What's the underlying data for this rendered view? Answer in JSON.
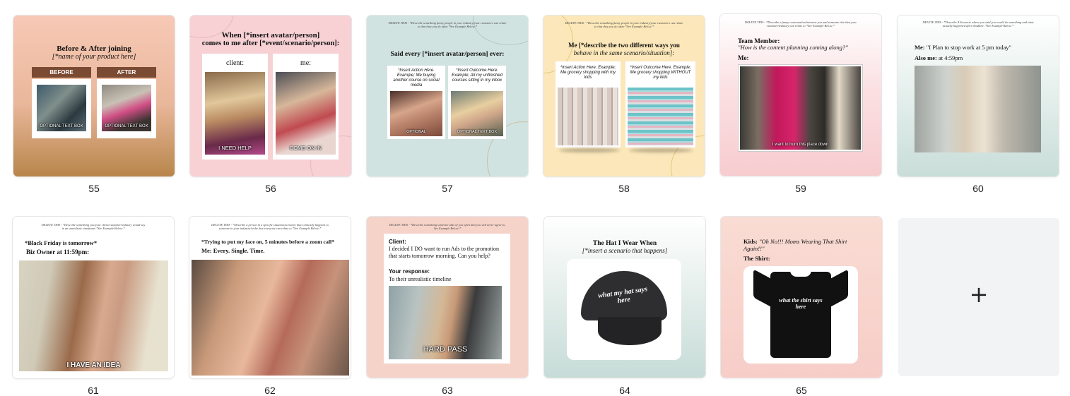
{
  "pages": [
    {
      "number": "55",
      "title_line1": "Before & After joining",
      "title_line2": "[*name of your product here]",
      "before_label": "BEFORE",
      "after_label": "AFTER",
      "caption_left": "OPTIONAL TEXT BOX",
      "caption_right": "OPTIONAL TEXT BOX"
    },
    {
      "number": "56",
      "title_line1": "When [*insert avatar/person]",
      "title_line2": "comes to me after [*event/scenario/person]:",
      "left_label": "client:",
      "right_label": "me:",
      "caption_left": "I NEED HELP",
      "caption_right": "COME ON IN"
    },
    {
      "number": "57",
      "note": "DELETE THIS - *Describe something funny people in your industry/your customers can relate to that they you do often *See Example Below:*",
      "title": "Said every [*insert avatar/person] ever:",
      "card_left": "*Insert Action Here. Example; Me buying another course on social media",
      "card_right": "*Insert Outcome Here. Example; All my unfinished courses sitting in my inbox",
      "caption_left": "OPTIONAL",
      "caption_right": "OPTIONAL TEXT BOX"
    },
    {
      "number": "58",
      "note": "DELETE THIS - *Describe something funny people in your industry/your customers can relate to that they you do often *See Example Below:*",
      "title_line1": "Me [*describe the two different ways you",
      "title_line2": "behave in the same scenario/situation]:",
      "card_left": "*Insert Action Here. Example; Me grocery shopping with my kids",
      "card_right": "*Insert Outcome Here. Example; Me grocery shopping WITHOUT my kids"
    },
    {
      "number": "59",
      "note": "DELETE THIS - *Describe a funny conversation between you and someone else that your customer/industry can relate to *See Example Below:*",
      "label_team": "Team Member:",
      "quote": "\"How is the content planning coming along?\"",
      "label_me": "Me:",
      "caption": "I want to burn this place down"
    },
    {
      "number": "60",
      "note": "DELETE THIS - *Describe A Scenario where you said you would do something and what actually happened after deadline. *See Example Below:*",
      "me_label": "Me:",
      "me_text": "\"I Plan to stop work at 5 pm today\"",
      "also_label": "Also me:",
      "also_text": "at 4:59pm"
    },
    {
      "number": "61",
      "note": "DELETE THIS - *Describe something you/your client/customer/industry would say in an unrealistic timeframe *See Example Below:*",
      "line1": "*Black Friday is tomorrow*",
      "line2": "Biz Owner at 11:59pm:",
      "caption": "I HAVE AN IDEA"
    },
    {
      "number": "62",
      "note": "DELETE THIS - *Describe a person in a specific situation/scenario that comically happens to someone in your industry/niche that everyone can relate to *See Example Below:*",
      "line1": "*Trying to put my face on, 5 minutes before a zoom call*",
      "line2": "Me: Every. Single. Time."
    },
    {
      "number": "63",
      "note": "DELETE THIS - *Describe something someone asks of you often that you will never agree to. See Example Below:*",
      "client_label": "Client:",
      "client_text": "I decided I DO want to run Ads to the promotion that starts tomorrow morning. Can you help?",
      "response_label": "Your response:",
      "response_text": "To their unrealistic timeline",
      "caption": "HARD PASS"
    },
    {
      "number": "64",
      "title_line1": "The Hat I Wear When",
      "title_line2": "[*insert a scenario that happens]",
      "hat_text": "what my hat says here"
    },
    {
      "number": "65",
      "line1_label": "Kids:",
      "line1_text": "\"Oh No!!! Moms Wearing That Shirt Again!!\"",
      "line2": "The Shirt:",
      "shirt_text": "what the shirt says here"
    }
  ],
  "add_page": {
    "icon": "plus-icon",
    "symbol": "+"
  },
  "colors": {
    "peach": "#f6c7b4",
    "pink": "#f7d1d4",
    "mint": "#d2e3df",
    "cream": "#fbe7b9",
    "brown": "#7b4a33"
  }
}
